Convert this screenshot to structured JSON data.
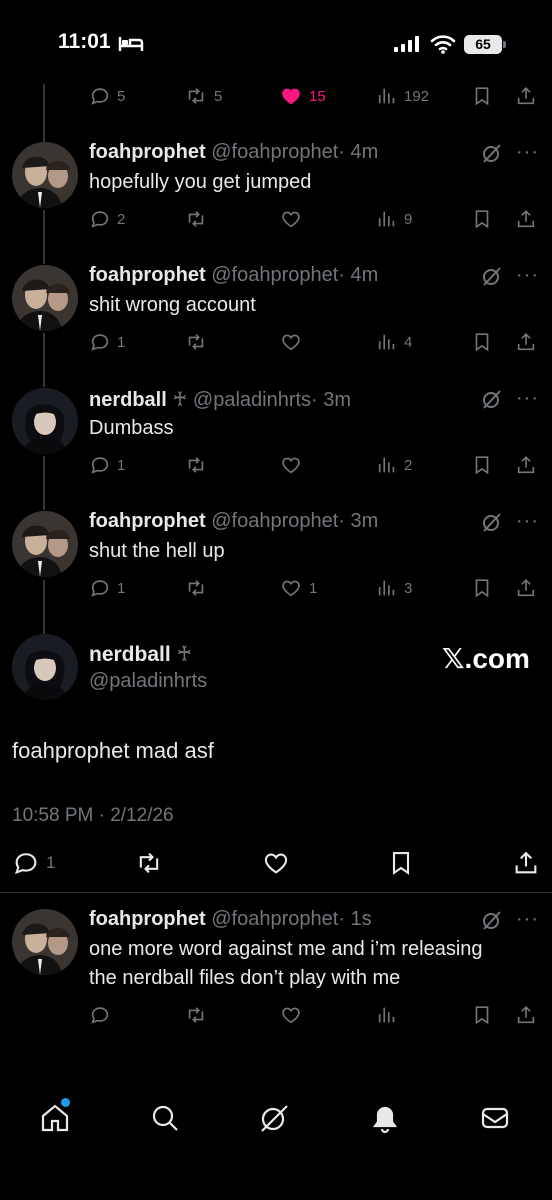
{
  "status_bar": {
    "time": "11:01",
    "battery": "65"
  },
  "top_actions": {
    "replies": "5",
    "reposts": "5",
    "likes": "15",
    "views": "192"
  },
  "tweets": [
    {
      "name": "foahprophet",
      "handle": "@foahprophet",
      "time": "· 4m",
      "text": "hopefully you get jumped",
      "replies": "2",
      "reposts": "",
      "likes": "",
      "views": "9"
    },
    {
      "name": "foahprophet",
      "handle": "@foahprophet",
      "time": "· 4m",
      "text": "shit wrong account",
      "replies": "1",
      "reposts": "",
      "likes": "",
      "views": "4"
    },
    {
      "name": "nerdball",
      "badge": "♰",
      "handle": "@paladinhrts",
      "time": "· 3m",
      "text": "Dumbass",
      "replies": "1",
      "reposts": "",
      "likes": "",
      "views": "2"
    },
    {
      "name": "foahprophet",
      "handle": "@foahprophet",
      "time": "· 3m",
      "text": "shut the hell up",
      "replies": "1",
      "reposts": "",
      "likes": "1",
      "views": "3"
    }
  ],
  "focused_tweet": {
    "name": "nerdball",
    "badge": "♰",
    "handle": "@paladinhrts",
    "watermark": "𝕏.com",
    "text": "foahprophet mad asf",
    "timestamp": "10:58 PM · 2/12/26",
    "replies": "1"
  },
  "reply_tweet": {
    "name": "foahprophet",
    "handle": "@foahprophet",
    "time": "· 1s",
    "text_line1": "one more word against me and i’m releasing",
    "text_line2": "the nerdball files don’t play with me"
  },
  "nav": [
    "home-icon",
    "search-icon",
    "grok-icon",
    "notifications-icon",
    "messages-icon"
  ],
  "colors": {
    "background": "#000000",
    "text": "#e7e9ea",
    "muted": "#71767b",
    "like": "#f91880",
    "accent": "#1d9bf0"
  }
}
